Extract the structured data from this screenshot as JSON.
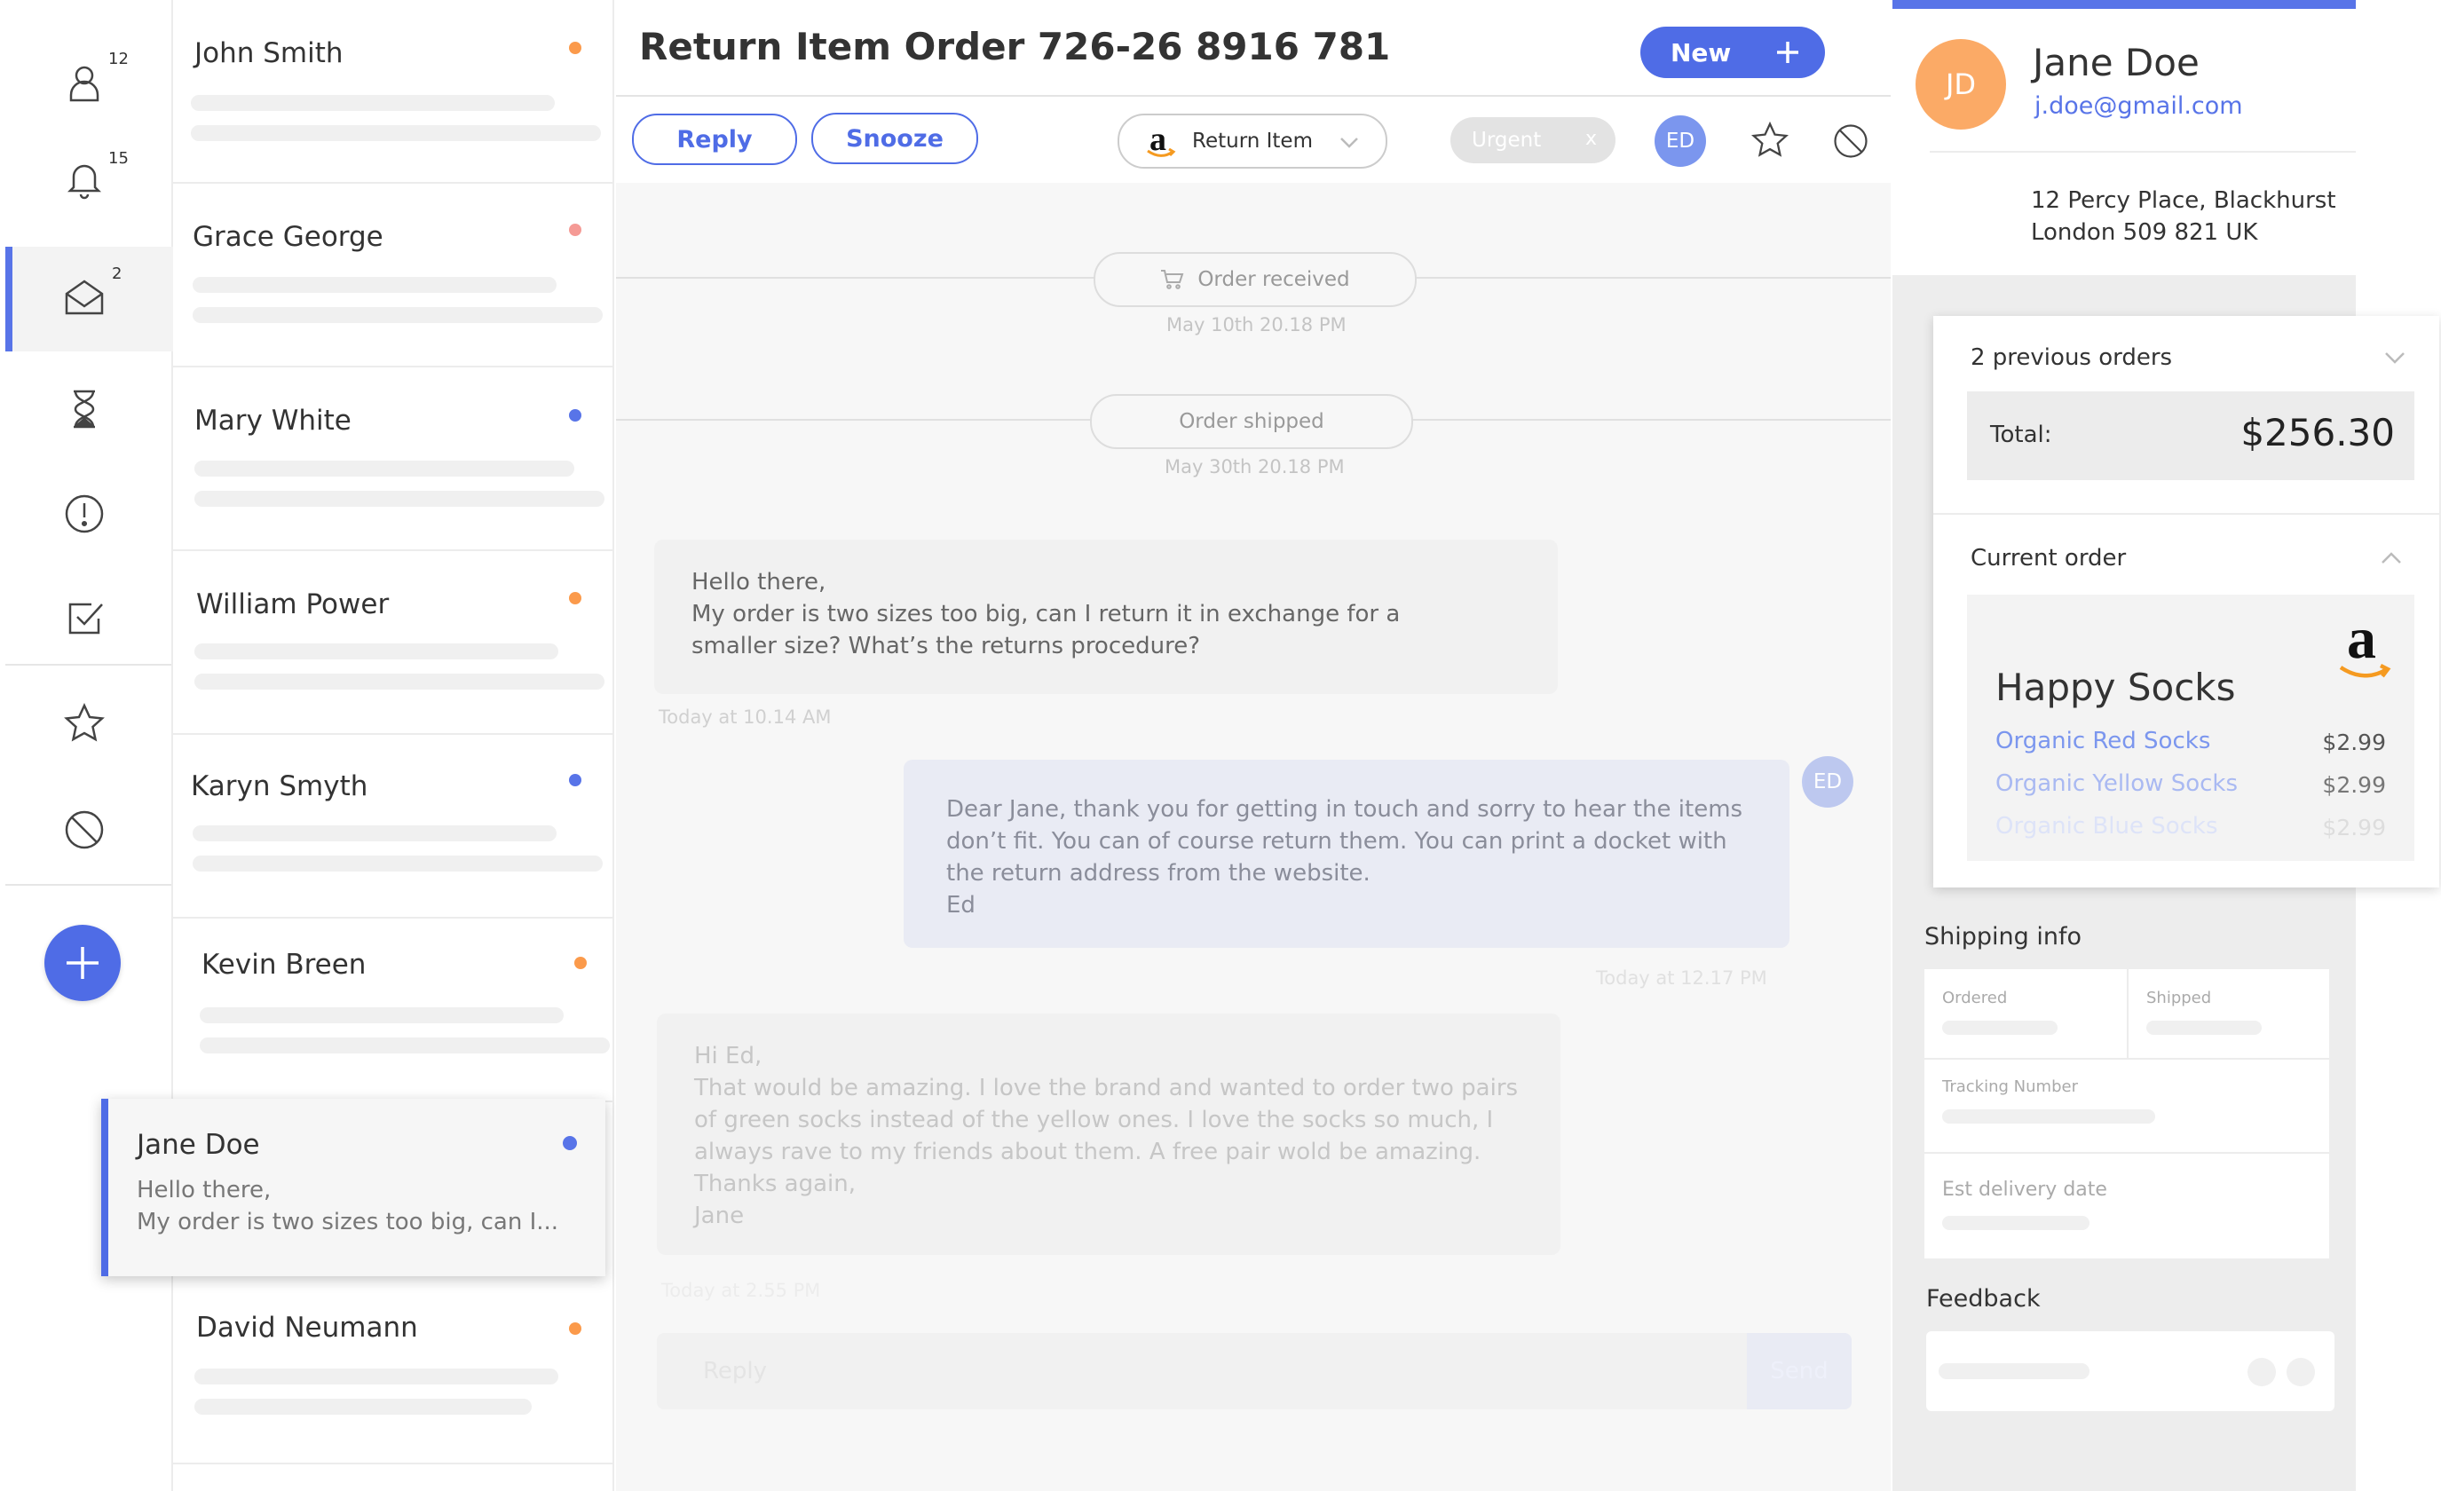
{
  "rail": {
    "badges": {
      "contacts": "12",
      "notifications": "15",
      "inbox": "2"
    }
  },
  "contacts": [
    {
      "name": "John Smith",
      "dot": "#fb9a4b"
    },
    {
      "name": "Grace George",
      "dot": "#f59a95"
    },
    {
      "name": "Mary White",
      "dot": "#5874e8"
    },
    {
      "name": "William Power",
      "dot": "#fb9a4b"
    },
    {
      "name": "Karyn Smyth",
      "dot": "#5874e8"
    },
    {
      "name": "Kevin Breen",
      "dot": "#fb9a4b"
    },
    {
      "name": "David Neumann",
      "dot": "#fb9a4b"
    }
  ],
  "selected_contact": {
    "name": "Jane Doe",
    "dot": "#5874e8",
    "preview_line1": "Hello there,",
    "preview_line2": "My order is two sizes too big, can I..."
  },
  "header": {
    "title": "Return Item Order 726-26 8916 781",
    "new_label": "New",
    "reply_label": "Reply",
    "snooze_label": "Snooze",
    "tag_label": "Return Item",
    "urgent_label": "Urgent",
    "urgent_close": "x",
    "agent_initials": "ED"
  },
  "events": [
    {
      "label": "Order received",
      "date": "May 10th 20.18 PM"
    },
    {
      "label": "Order shipped",
      "date": "May 30th 20.18 PM"
    }
  ],
  "messages": [
    {
      "lines": [
        "Hello there,",
        "My order is two sizes too big, can I return it in exchange for a",
        "smaller size? What’s the returns procedure?"
      ],
      "stamp": "Today at 10.14 AM"
    },
    {
      "lines": [
        "Dear Jane, thank you for getting in touch and sorry to hear the items",
        "don’t fit. You can of course return them. You can print a docket with",
        "the return address from the website.",
        "Ed"
      ],
      "stamp": "Today at 12.17 PM",
      "initials": "ED"
    },
    {
      "lines": [
        "Hi Ed,",
        "That would be amazing. I love the brand and wanted to order two pairs",
        "of green socks instead of the yellow ones. I love the socks so much, I",
        "always rave to my friends about them. A free pair wold be amazing.",
        "Thanks again,",
        "Jane"
      ],
      "stamp": "Today at 2.55 PM"
    }
  ],
  "composer": {
    "placeholder": "Reply",
    "send_label": "Send"
  },
  "customer": {
    "initials": "JD",
    "name": "Jane Doe",
    "email": "j.doe@gmail.com",
    "address_line1": "12 Percy Place, Blackhurst",
    "address_line2": "London 509 821 UK"
  },
  "orders": {
    "previous_label": "2 previous orders",
    "total_label": "Total:",
    "total_value": "$256.30",
    "current_label": "Current order",
    "store_name": "Happy Socks",
    "items": [
      {
        "name": "Organic Red Socks",
        "price": "$2.99"
      },
      {
        "name": "Organic Yellow Socks",
        "price": "$2.99"
      },
      {
        "name": "Organic Blue Socks",
        "price": "$2.99"
      }
    ]
  },
  "shipping": {
    "title": "Shipping info",
    "ordered_label": "Ordered",
    "shipped_label": "Shipped",
    "tracking_label": "Tracking Number",
    "delivery_label": "Est delivery date"
  },
  "feedback": {
    "title": "Feedback"
  },
  "colors": {
    "accent": "#4f6ce6",
    "orange": "#fb9a4b",
    "avatar_orange": "#fbaa66"
  }
}
